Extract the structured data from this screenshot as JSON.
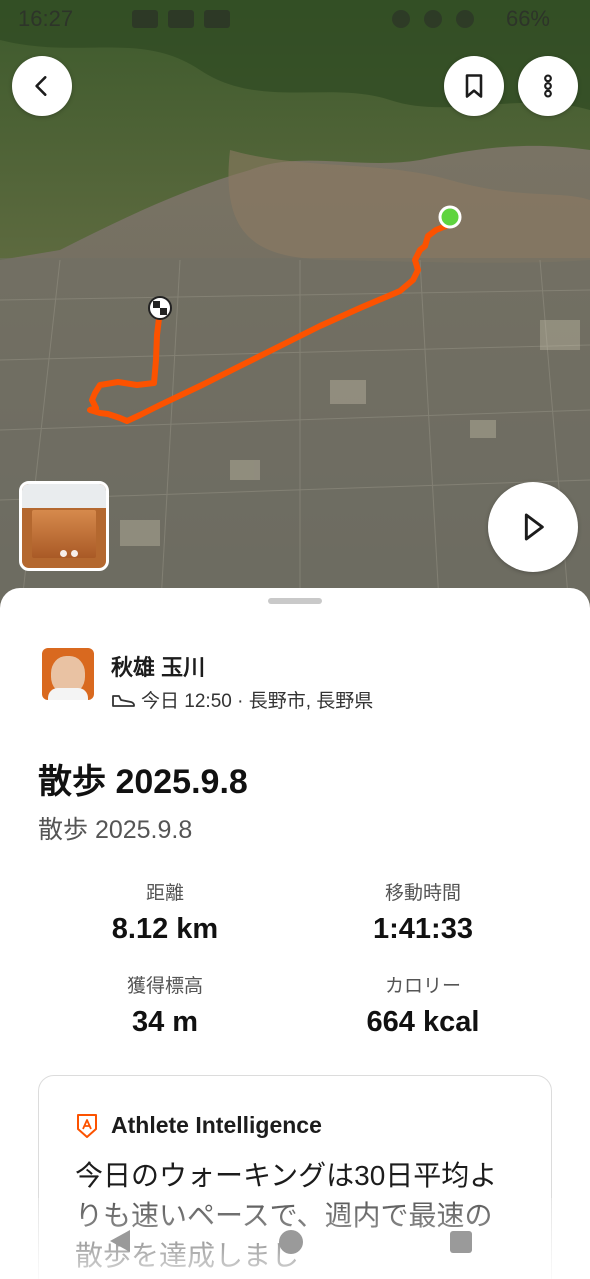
{
  "status_bar": {
    "time": "16:27",
    "battery": "66%"
  },
  "map": {
    "icons": {
      "back": "chevron-left-icon",
      "bookmark": "bookmark-icon",
      "more": "more-vertical-icon",
      "play": "play-icon",
      "start": "start-marker-icon",
      "finish": "finish-flag-icon"
    },
    "route_color": "#fc5200",
    "start_marker_color": "#5fd43f"
  },
  "athlete": {
    "name": "秋雄 玉川",
    "activity_icon": "shoe-icon",
    "meta": "今日 12:50 · 長野市, 長野県"
  },
  "activity": {
    "title": "散歩 2025.9.8",
    "description": "散歩 2025.9.8"
  },
  "stats": {
    "distance": {
      "label": "距離",
      "value": "8.12 km"
    },
    "moving_time": {
      "label": "移動時間",
      "value": "1:41:33"
    },
    "elevation_gain": {
      "label": "獲得標高",
      "value": "34 m"
    },
    "calories": {
      "label": "カロリー",
      "value": "664 kcal"
    }
  },
  "athlete_intelligence": {
    "icon": "athlete-intelligence-icon",
    "title": "Athlete Intelligence",
    "text": "今日のウォーキングは30日平均よりも速いペースで、週内で最速の散歩を達成しまし"
  },
  "colors": {
    "brand": "#fc5200"
  }
}
